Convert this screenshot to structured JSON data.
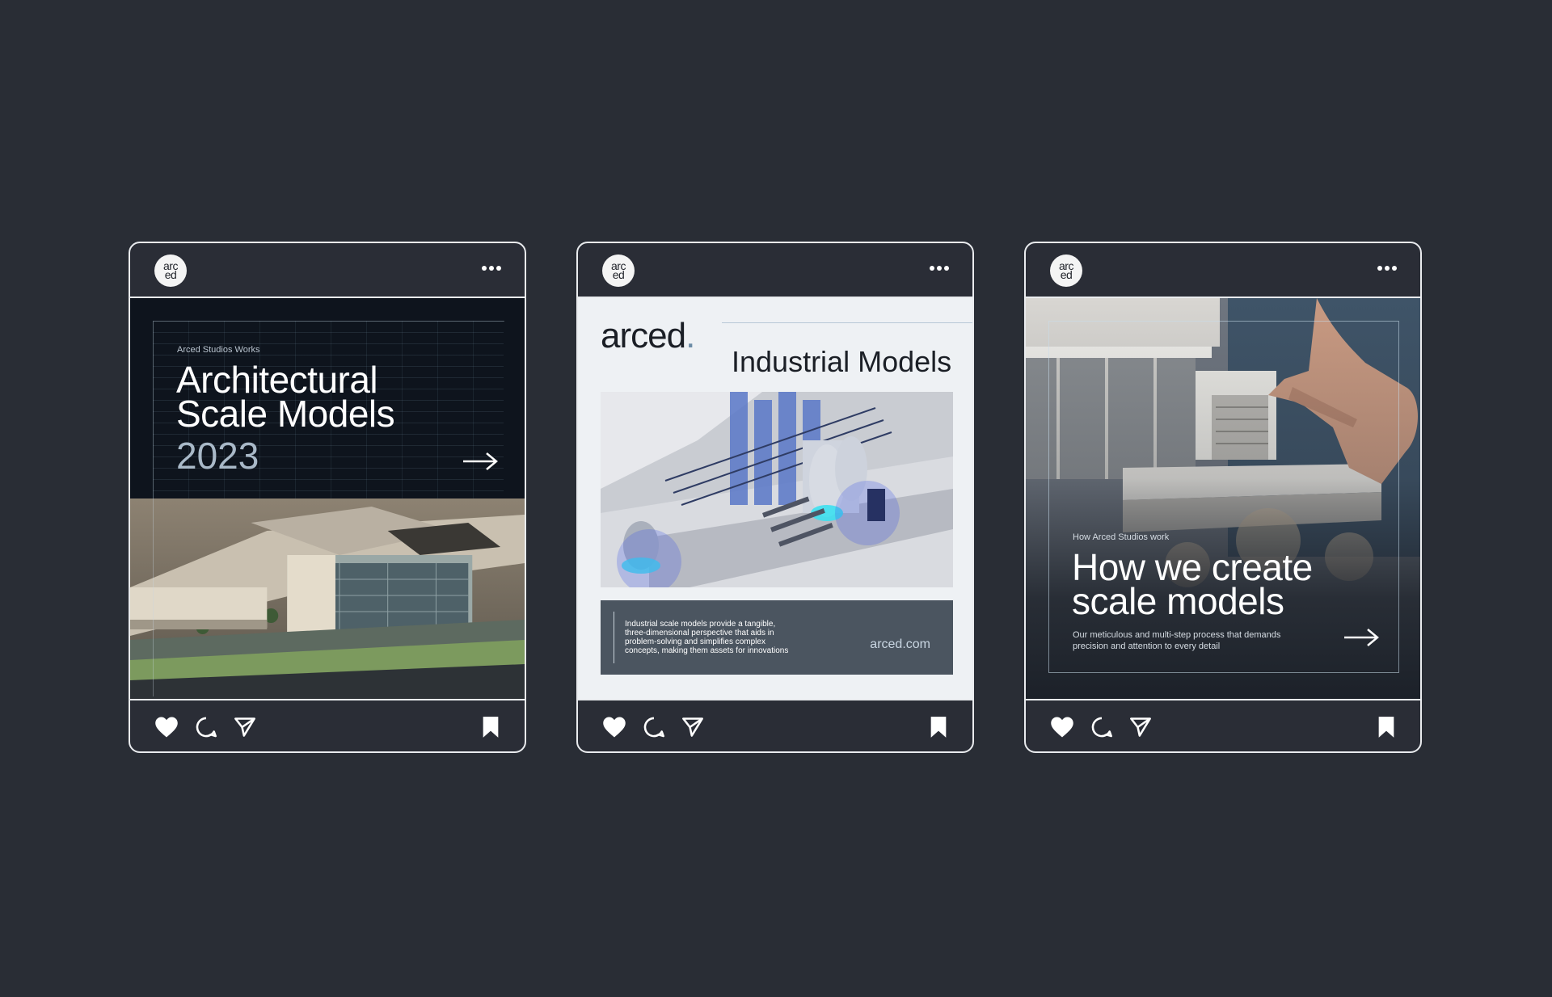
{
  "background_color": "#292d35",
  "icons": {
    "more": "more-horizontal-icon",
    "like": "heart-icon",
    "comment": "comment-icon",
    "share": "send-icon",
    "save": "bookmark-icon",
    "next": "arrow-right-icon"
  },
  "posts": [
    {
      "avatar_top": "arc",
      "avatar_bottom": "ed",
      "kicker": "Arced Studios Works",
      "title_line1": "Architectural",
      "title_line2": "Scale Models",
      "year": "2023"
    },
    {
      "avatar_top": "arc",
      "avatar_bottom": "ed",
      "logo": "arced",
      "logo_dot": ".",
      "title": "Industrial Models",
      "body": "Industrial scale models provide a tangible, three-dimensional perspective that aids in problem-solving and simplifies complex concepts, making them assets for innovations",
      "link": "arced.com"
    },
    {
      "avatar_top": "arc",
      "avatar_bottom": "ed",
      "kicker": "How Arced Studios work",
      "title_line1": "How we create",
      "title_line2": "scale models",
      "subtitle": "Our meticulous and multi-step process that demands precision and attention to every detail"
    }
  ]
}
